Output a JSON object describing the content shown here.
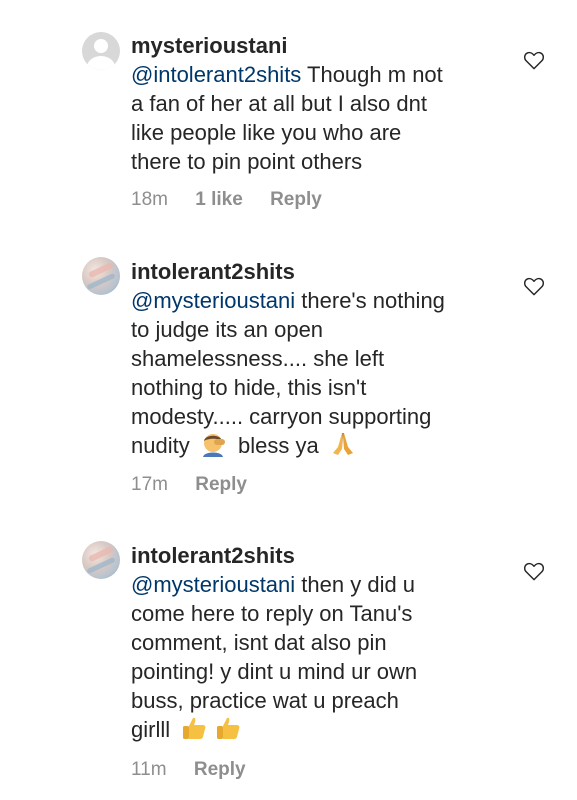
{
  "comments": [
    {
      "username": "mysterioustani",
      "mention": "@intolerant2shits",
      "text_first": " Though m not",
      "lines": [
        "a fan of her at all but I also dnt",
        "like people like you who are",
        "there to pin point others"
      ],
      "time": "18m",
      "likes": "1 like",
      "reply": "Reply",
      "avatar": "default-avatar-icon"
    },
    {
      "username": "intolerant2shits",
      "mention": "@mysterioustani",
      "text_first": " there's nothing",
      "lines": [
        "to judge its an open",
        "shamelessness.... she left",
        "nothing to hide,  this isn't",
        "modesty..... carryon supporting"
      ],
      "last_a": "nudity",
      "last_b": "bless ya",
      "time": "17m",
      "reply": "Reply",
      "avatar": "profile-photo"
    },
    {
      "username": "intolerant2shits",
      "mention": "@mysterioustani",
      "text_first": " then y did u",
      "lines": [
        "come here to reply on Tanu's",
        "comment,  isnt dat also pin",
        "pointing!  y dint u mind ur own",
        "buss, practice wat u preach"
      ],
      "last_a": "girlll",
      "time": "11m",
      "reply": "Reply",
      "avatar": "profile-photo"
    }
  ],
  "icons": {
    "heart": "heart-outline-icon",
    "emoji_1": "man-facepalming-emoji",
    "emoji_2": "folded-hands-emoji",
    "emoji_3": "thumbs-up-emoji"
  },
  "colors": {
    "mention": "#00376b",
    "meta": "#8e8e8e",
    "text": "#262626"
  }
}
